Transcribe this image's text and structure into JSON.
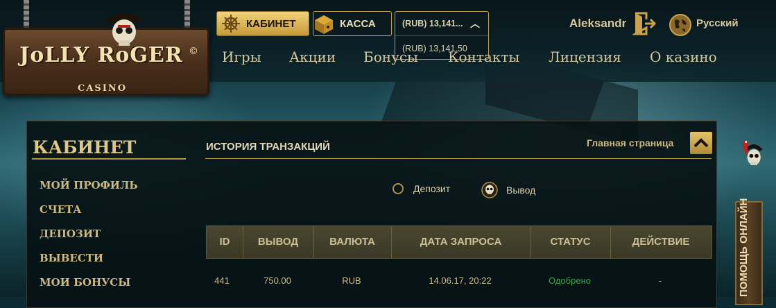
{
  "brand": {
    "logo_text": "JoLLY RoGER",
    "logo_sub": "CASINO",
    "copyright": "©"
  },
  "header": {
    "cabinet_label": "КАБИНЕТ",
    "kassa_label": "КАССА",
    "balance_selected": "(RUB) 13,141...",
    "balance_option": "(RUB) 13,141.50",
    "username": "Aleksandr",
    "language": "Русский"
  },
  "nav": {
    "items": [
      "Игры",
      "Акции",
      "Бонусы",
      "Контакты",
      "Лицензия",
      "О казино"
    ]
  },
  "sidebar": {
    "title": "КАБИНЕТ",
    "items": [
      "МОЙ ПРОФИЛЬ",
      "СЧЕТА",
      "ДЕПОЗИТ",
      "ВЫВЕСТИ",
      "МОИ БОНУСЫ"
    ]
  },
  "main": {
    "title": "ИСТОРИЯ ТРАНЗАКЦИЙ",
    "home_link": "Главная страница",
    "filter": {
      "deposit": "Депозит",
      "withdraw": "Вывод",
      "selected": "Вывод"
    },
    "table": {
      "headers": [
        "ID",
        "ВЫВОД",
        "ВАЛЮТА",
        "ДАТА ЗАПРОСА",
        "СТАТУС",
        "ДЕЙСТВИЕ"
      ],
      "rows": [
        [
          "441",
          "750.00",
          "RUB",
          "14.06.17, 20:22",
          "Одобрено",
          "-"
        ]
      ]
    }
  },
  "help": {
    "label": "ПОМОЩЬ ОНЛАЙН"
  },
  "colors": {
    "gold": "#c5a04a",
    "status_approved": "#3fa848",
    "panel_bg": "#061114"
  }
}
